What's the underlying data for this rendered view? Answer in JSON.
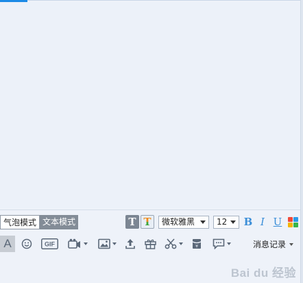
{
  "format_bar": {
    "bubble_mode_label": "气泡模式",
    "text_mode_label": "文本模式",
    "font_name": "微软雅黑",
    "font_size": "12",
    "bold_label": "B",
    "italic_label": "I",
    "underline_label": "U"
  },
  "toolbar": {
    "font_tool_label": "A",
    "gif_label": "GIF",
    "history_label": "消息记录"
  },
  "watermark": {
    "text": "Bai du 经验"
  },
  "colors": {
    "accent": "#1c8ae6",
    "background": "#ecf1f9",
    "icon": "#5b6878",
    "style_buttons": "#3d8fd8",
    "inactive_mode": "#838c97"
  },
  "icons": [
    "font-icon",
    "emoji-icon",
    "gif-icon",
    "video-call-icon",
    "image-icon",
    "upload-file-icon",
    "gift-icon",
    "scissors-icon",
    "red-packet-icon",
    "chat-bubble-icon"
  ]
}
